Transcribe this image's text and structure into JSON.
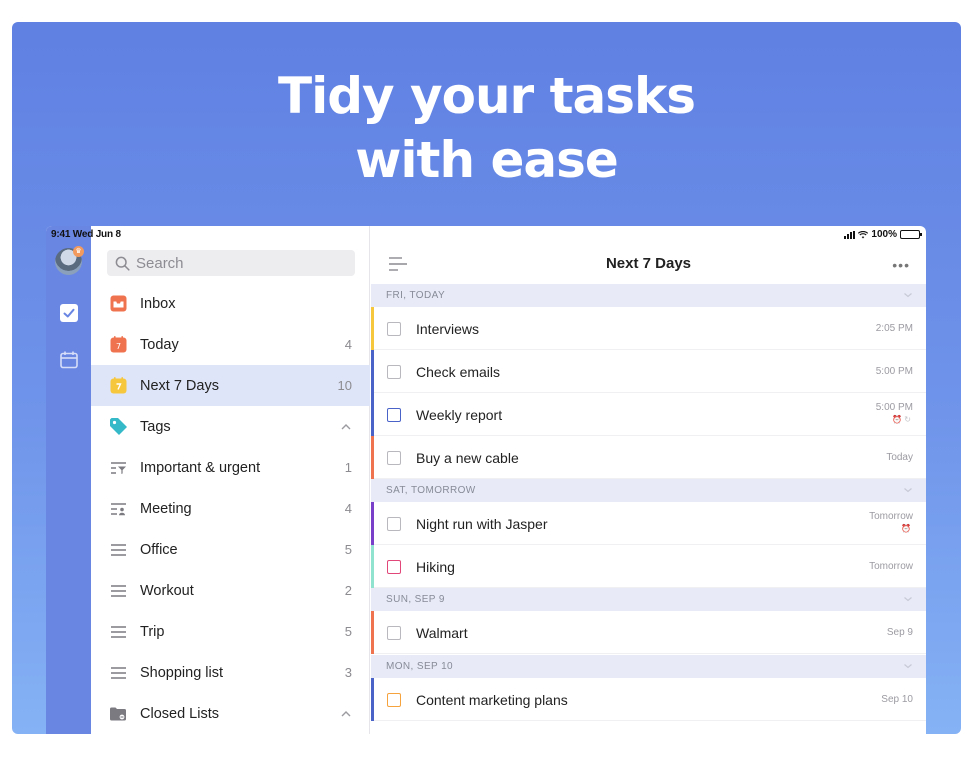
{
  "headline": {
    "line1": "Tidy your tasks",
    "line2": "with ease"
  },
  "status_bar": {
    "time": "9:41  Wed Jun 8",
    "battery": "100%"
  },
  "rail": {
    "avatar": "user-avatar",
    "items": [
      {
        "icon": "checkbox-icon",
        "active": true
      },
      {
        "icon": "calendar-icon",
        "active": false
      }
    ]
  },
  "sidebar": {
    "search_placeholder": "Search",
    "items": [
      {
        "label": "Inbox",
        "count": "",
        "icon": "inbox-icon",
        "color": "#f0734f"
      },
      {
        "label": "Today",
        "count": "4",
        "icon": "calendar-today-icon",
        "color": "#f0734f",
        "icon_text": "7"
      },
      {
        "label": "Next 7 Days",
        "count": "10",
        "icon": "calendar-week-icon",
        "color": "#f6c63d",
        "active": true
      },
      {
        "label": "Tags",
        "count": "",
        "icon": "tag-icon",
        "color": "#35b9c9",
        "chevron": "up"
      },
      {
        "label": "Important & urgent",
        "count": "1",
        "icon": "filter-icon"
      },
      {
        "label": "Meeting",
        "count": "4",
        "icon": "people-list-icon"
      },
      {
        "label": "Office",
        "count": "5",
        "icon": "list-icon"
      },
      {
        "label": "Workout",
        "count": "2",
        "icon": "list-icon"
      },
      {
        "label": "Trip",
        "count": "5",
        "icon": "list-icon"
      },
      {
        "label": "Shopping list",
        "count": "3",
        "icon": "list-icon"
      },
      {
        "label": "Closed Lists",
        "count": "",
        "icon": "archive-folder-icon",
        "chevron": "up"
      }
    ]
  },
  "main": {
    "title": "Next 7 Days",
    "sections": [
      {
        "label": "FRI, TODAY"
      },
      {
        "label": "SAT, TOMORROW"
      },
      {
        "label": "SUN, SEP 9"
      },
      {
        "label": "MON, SEP 10"
      }
    ],
    "tasks": [
      {
        "label": "Interviews",
        "meta": "2:05 PM",
        "bar": "#f6c63d",
        "checkbox": "#b8b8be"
      },
      {
        "label": "Check emails",
        "meta": "5:00 PM",
        "bar": "#4a63c9",
        "checkbox": "#b8b8be"
      },
      {
        "label": "Weekly report",
        "meta": "5:00 PM",
        "bar": "#4a63c9",
        "checkbox": "#4a63c9",
        "sub": "icons"
      },
      {
        "label": "Buy a new cable",
        "meta": "Today",
        "bar": "#f0734f",
        "checkbox": "#b8b8be"
      },
      {
        "label": "Night run with Jasper",
        "meta": "Tomorrow",
        "bar": "#7a3fc9",
        "checkbox": "#b8b8be",
        "sub": "icon"
      },
      {
        "label": "Hiking",
        "meta": "Tomorrow",
        "bar": "#8fe3cf",
        "checkbox": "#e2477a"
      },
      {
        "label": "Walmart",
        "meta": "Sep 9",
        "bar": "#f0734f",
        "checkbox": "#b8b8be"
      },
      {
        "label": "Content marketing plans",
        "meta": "Sep 10",
        "bar": "#4a63c9",
        "checkbox": "#f6a23d"
      }
    ]
  }
}
